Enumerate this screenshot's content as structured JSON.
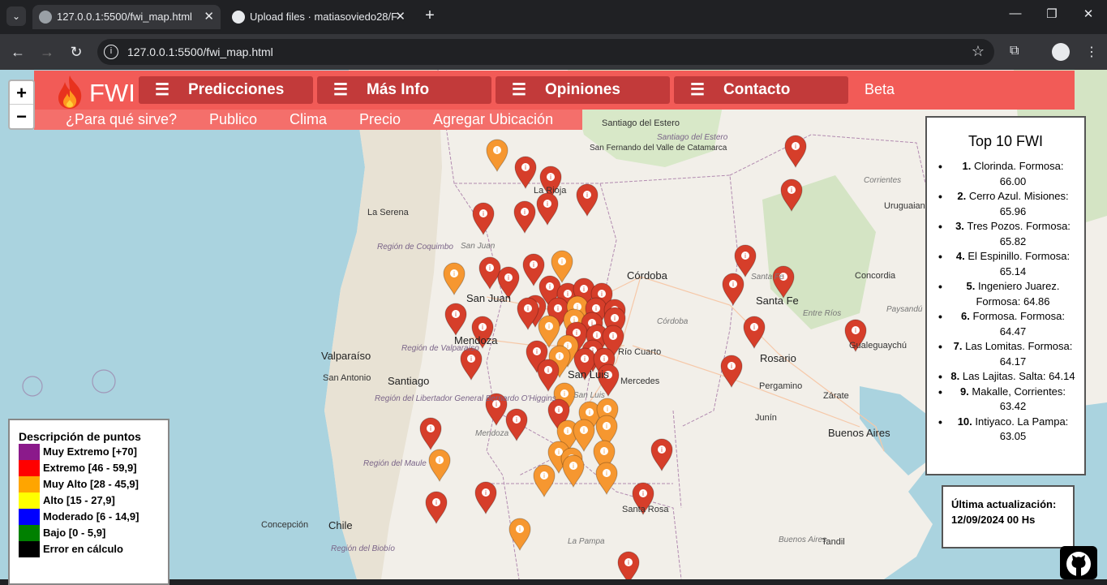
{
  "browser": {
    "menu_icon": "chevron-down-icon",
    "tabs": [
      {
        "title": "127.0.0.1:5500/fwi_map.html",
        "icon": "globe-icon",
        "active": true
      },
      {
        "title": "Upload files · matiasoviedo28/F",
        "icon": "github-icon",
        "active": false
      }
    ],
    "url": "127.0.0.1:5500/fwi_map.html",
    "newtab": "+"
  },
  "zoom": {
    "in": "+",
    "out": "−"
  },
  "app": {
    "logo_text": "FWI",
    "nav": [
      {
        "label": "Predicciones"
      },
      {
        "label": "Más Info"
      },
      {
        "label": "Opiniones"
      },
      {
        "label": "Contacto"
      }
    ],
    "beta": "Beta",
    "subnav": [
      {
        "label": "¿Para qué sirve?"
      },
      {
        "label": "Publico"
      },
      {
        "label": "Clima"
      },
      {
        "label": "Precio"
      },
      {
        "label": "Agregar Ubicación"
      }
    ]
  },
  "top10": {
    "title": "Top 10 FWI",
    "items": [
      {
        "rank": "1.",
        "text": "Clorinda. Formosa: 66.00"
      },
      {
        "rank": "2.",
        "text": "Cerro Azul. Misiones: 65.96"
      },
      {
        "rank": "3.",
        "text": "Tres Pozos. Formosa: 65.82"
      },
      {
        "rank": "4.",
        "text": "El Espinillo. Formosa: 65.14"
      },
      {
        "rank": "5.",
        "text": "Ingeniero Juarez. Formosa: 64.86"
      },
      {
        "rank": "6.",
        "text": "Formosa. Formosa: 64.47"
      },
      {
        "rank": "7.",
        "text": "Las Lomitas. Formosa: 64.17"
      },
      {
        "rank": "8.",
        "text": "Las Lajitas. Salta: 64.14"
      },
      {
        "rank": "9.",
        "text": "Makalle, Corrientes: 63.42"
      },
      {
        "rank": "10.",
        "text": "Intiyaco. La Pampa: 63.05"
      }
    ]
  },
  "updated": {
    "label": "Última actualización:",
    "value": "12/09/2024 00 Hs"
  },
  "legend": {
    "title": "Descripción de puntos",
    "items": [
      {
        "label": "Muy Extremo [+70]",
        "color": "#8b1a8b"
      },
      {
        "label": "Extremo [46 - 59,9]",
        "color": "#ff0000"
      },
      {
        "label": "Muy Alto [28 - 45,9]",
        "color": "#ffa500"
      },
      {
        "label": "Alto [15 - 27,9]",
        "color": "#ffff00"
      },
      {
        "label": "Moderado [6 - 14,9]",
        "color": "#0000ff"
      },
      {
        "label": "Bajo [0 - 5,9]",
        "color": "#008000"
      },
      {
        "label": "Error en cálculo",
        "color": "#000000"
      }
    ]
  },
  "map_labels": [
    "Santiago del Estero",
    "San Fernando del Valle de Catamarca",
    "Santiago del Estero",
    "Corrientes",
    "Uruguaiana",
    "La Serena",
    "La Rioja",
    "San Juan",
    "Región de Coquimbo",
    "San Juan",
    "Córdoba",
    "Santa Fe",
    "Concordia",
    "Santa Fe",
    "Entre Ríos",
    "Paysandú",
    "Mendoza",
    "Córdoba",
    "Gualeguaychú",
    "Valparaíso",
    "Región de Valparaíso",
    "Río Cuarto",
    "Rosario",
    "San Antonio",
    "Santiago",
    "San Luis",
    "Mercedes",
    "Pergamino",
    "Región del Libertador General Bernardo O'Higgins",
    "Zárate",
    "San Luis",
    "Junín",
    "Mendoza",
    "Buenos Aires",
    "Región del Maule",
    "Concepción",
    "Chile",
    "Santa Rosa",
    "Región del Biobío",
    "La Pampa",
    "Buenos Aires",
    "Tandil"
  ],
  "colors": {
    "navbar": "#f25b57",
    "navbtn": "#c23a3a",
    "subnav": "#f46f6b",
    "marker_red": "#d63e2a",
    "marker_orange": "#f69730"
  }
}
